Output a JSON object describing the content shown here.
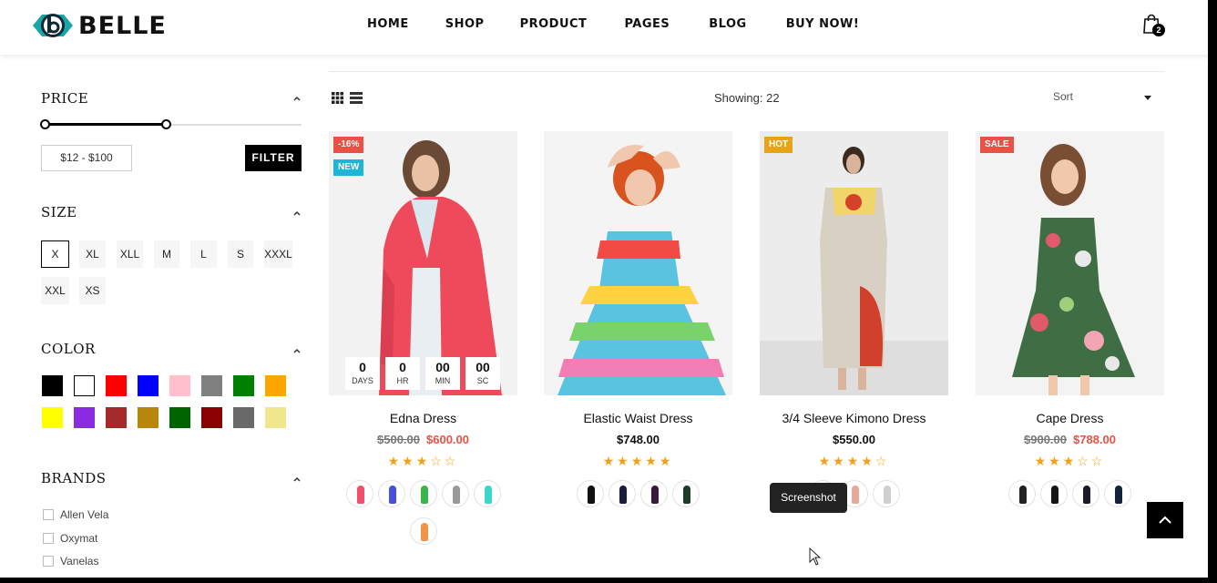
{
  "header": {
    "logo_text": "BELLE",
    "nav": [
      "HOME",
      "SHOP",
      "PRODUCT",
      "PAGES",
      "BLOG",
      "BUY NOW!"
    ],
    "cart_count": "2"
  },
  "sidebar": {
    "price": {
      "title": "PRICE",
      "range_label": "$12 - $100",
      "filter_label": "FILTER"
    },
    "size": {
      "title": "SIZE",
      "options": [
        "X",
        "XL",
        "XLL",
        "M",
        "L",
        "S",
        "XXXL",
        "XXL",
        "XS"
      ],
      "selected": "X"
    },
    "color": {
      "title": "COLOR",
      "swatches": [
        "#000000",
        "#ffffff",
        "#ff0000",
        "#0000ff",
        "#ffc0cb",
        "#808080",
        "#008000",
        "#ffa500",
        "#ffff00",
        "#8a2be2",
        "#a52a2a",
        "#b8860b",
        "#006400",
        "#8b0000",
        "#696969",
        "#f0e68c"
      ]
    },
    "brands": {
      "title": "BRANDS",
      "items": [
        "Allen Vela",
        "Oxymat",
        "Vanelas"
      ]
    }
  },
  "toolbar": {
    "showing": "Showing: 22",
    "sort_label": "Sort"
  },
  "products": [
    {
      "name": "Edna Dress",
      "old_price": "$500.00",
      "price": "$600.00",
      "rating": 3,
      "badges": [
        "-16%",
        "NEW"
      ],
      "countdown": [
        {
          "value": "0",
          "label": "DAYS"
        },
        {
          "value": "0",
          "label": "HR"
        },
        {
          "value": "00",
          "label": "MIN"
        },
        {
          "value": "00",
          "label": "SC"
        }
      ],
      "variants": [
        "#ef4f6b",
        "#4650d8",
        "#3bb54a",
        "#9a9a9a",
        "#3ad6c9",
        "#f29447"
      ]
    },
    {
      "name": "Elastic Waist Dress",
      "old_price": "",
      "price": "$748.00",
      "rating": 5,
      "badges": [],
      "variants": [
        "#111111",
        "#1a1d3a",
        "#3a1a3a",
        "#1d3b2a"
      ]
    },
    {
      "name": "3/4 Sleeve Kimono Dress",
      "old_price": "",
      "price": "$550.00",
      "rating": 4,
      "badges": [
        "HOT"
      ],
      "variants": [
        "#d9b06a",
        "#e8a898",
        "#cfcfcf"
      ]
    },
    {
      "name": "Cape Dress",
      "old_price": "$900.00",
      "price": "$788.00",
      "rating": 3,
      "badges": [
        "SALE"
      ],
      "variants": [
        "#222222",
        "#151515",
        "#1b1b2b",
        "#10233a"
      ]
    }
  ],
  "tooltip": "Screenshot",
  "colors": {
    "sale": "#e95144",
    "new_badge": "#1fb5d6",
    "hot_badge": "#e8a317",
    "star": "#f0a01b",
    "brand_teal": "#1aa5a8"
  }
}
